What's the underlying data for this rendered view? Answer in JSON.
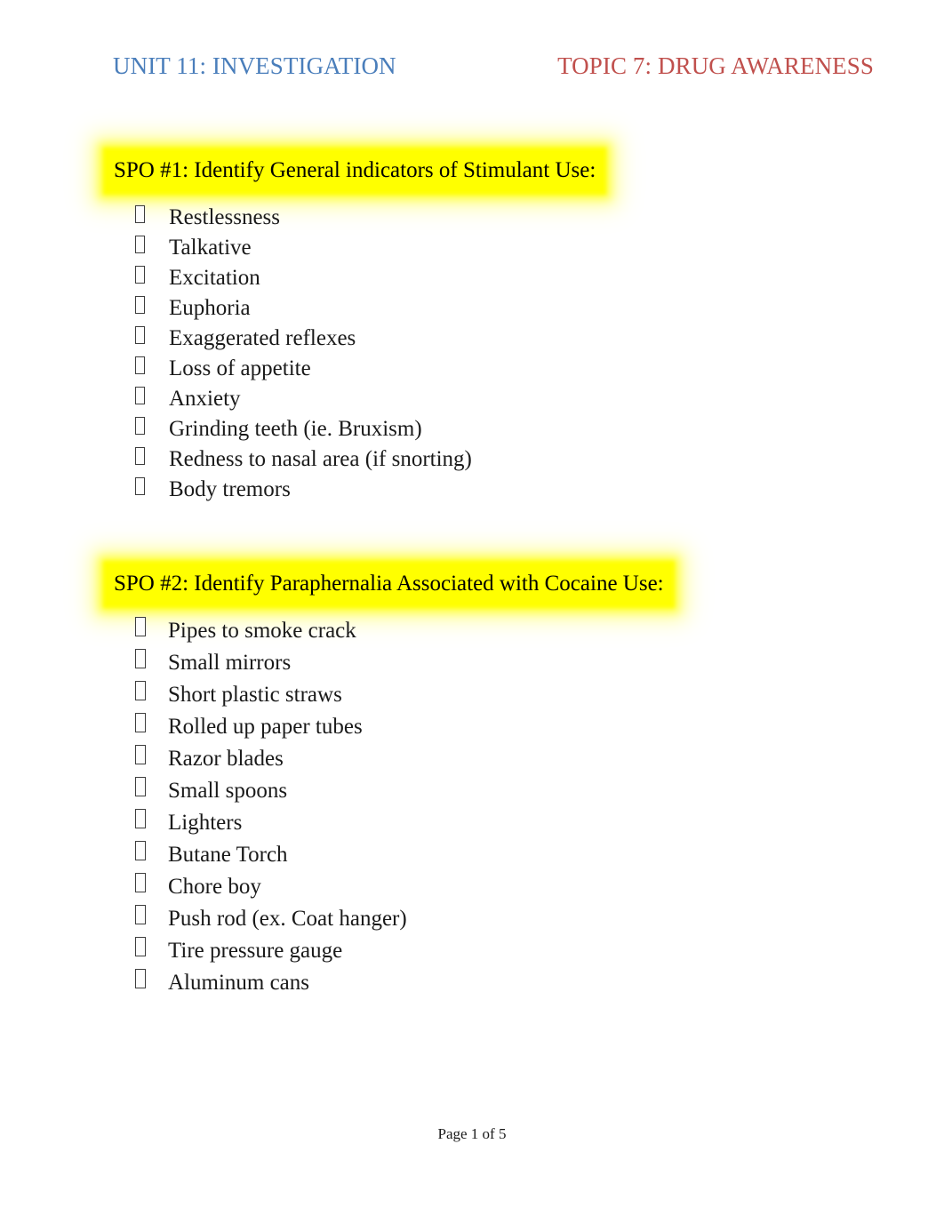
{
  "document": {
    "header": {
      "left_title": "UNIT 11: INVESTIGATION",
      "right_title": "TOPIC 7: DRUG AWARENESS",
      "left_color": "#4A7EBB",
      "right_color": "#C0504D"
    },
    "footer": {
      "page_text": "Page 1 of 5"
    },
    "highlight_color": "#FFFF00",
    "bullet_glyph": "missing-glyph-box",
    "sections": [
      {
        "heading": "SPO #1: Identify General indicators of Stimulant Use:",
        "items": [
          {
            "label": "Restlessness"
          },
          {
            "label": "Talkative"
          },
          {
            "label": "Excitation"
          },
          {
            "label": "Euphoria"
          },
          {
            "label": "Exaggerated reflexes"
          },
          {
            "label": "Loss of appetite"
          },
          {
            "label": "Anxiety"
          },
          {
            "label": "Grinding teeth (ie. Bruxism)"
          },
          {
            "label": "Redness to nasal area (if snorting)"
          },
          {
            "label": "Body tremors"
          }
        ]
      },
      {
        "heading": "SPO #2: Identify Paraphernalia Associated with Cocaine Use:",
        "items": [
          {
            "label": "Pipes to smoke crack"
          },
          {
            "label": "Small mirrors"
          },
          {
            "label": "Short plastic straws"
          },
          {
            "label": "Rolled up paper tubes"
          },
          {
            "label": "Razor blades"
          },
          {
            "label": "Small spoons"
          },
          {
            "label": "Lighters"
          },
          {
            "label": "Butane Torch"
          },
          {
            "label": "Chore boy"
          },
          {
            "label": "Push rod (ex. Coat hanger)"
          },
          {
            "label": "Tire pressure gauge"
          },
          {
            "label": "Aluminum cans"
          }
        ]
      }
    ]
  }
}
